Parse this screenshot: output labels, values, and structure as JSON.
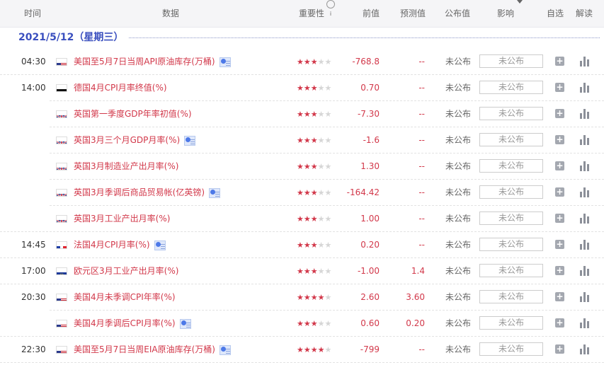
{
  "header": {
    "time": "时间",
    "data": "数据",
    "importance": "重要性",
    "previous": "前值",
    "forecast": "预测值",
    "actual": "公布值",
    "impact": "影响",
    "watchlist": "自选",
    "explain": "解读"
  },
  "date": "2021/5/12（星期三）",
  "rows": [
    {
      "time": "04:30",
      "flag": "us",
      "name": "美国至5月7日当周API原油库存(万桶)",
      "video": true,
      "stars": 3,
      "prev": "-768.8",
      "forecast": "--",
      "actual": "未公布",
      "impact": "未公布"
    },
    {
      "time": "14:00",
      "flag": "de",
      "name": "德国4月CPI月率终值(%)",
      "video": false,
      "stars": 3,
      "prev": "0.70",
      "forecast": "--",
      "actual": "未公布",
      "impact": "未公布"
    },
    {
      "time": "",
      "flag": "gb",
      "name": "英国第一季度GDP年率初值(%)",
      "video": false,
      "stars": 3,
      "prev": "-7.30",
      "forecast": "--",
      "actual": "未公布",
      "impact": "未公布"
    },
    {
      "time": "",
      "flag": "gb",
      "name": "英国3月三个月GDP月率(%)",
      "video": true,
      "stars": 3,
      "prev": "-1.6",
      "forecast": "--",
      "actual": "未公布",
      "impact": "未公布"
    },
    {
      "time": "",
      "flag": "gb",
      "name": "英国3月制造业产出月率(%)",
      "video": false,
      "stars": 3,
      "prev": "1.30",
      "forecast": "--",
      "actual": "未公布",
      "impact": "未公布"
    },
    {
      "time": "",
      "flag": "gb",
      "name": "英国3月季调后商品贸易帐(亿英镑)",
      "video": true,
      "stars": 3,
      "prev": "-164.42",
      "forecast": "--",
      "actual": "未公布",
      "impact": "未公布"
    },
    {
      "time": "",
      "flag": "gb",
      "name": "英国3月工业产出月率(%)",
      "video": false,
      "stars": 3,
      "prev": "1.00",
      "forecast": "--",
      "actual": "未公布",
      "impact": "未公布"
    },
    {
      "time": "14:45",
      "flag": "fr",
      "name": "法国4月CPI月率(%)",
      "video": true,
      "stars": 3,
      "prev": "0.20",
      "forecast": "--",
      "actual": "未公布",
      "impact": "未公布"
    },
    {
      "time": "17:00",
      "flag": "eu",
      "name": "欧元区3月工业产出月率(%)",
      "video": false,
      "stars": 3,
      "prev": "-1.00",
      "forecast": "1.4",
      "actual": "未公布",
      "impact": "未公布"
    },
    {
      "time": "20:30",
      "flag": "us",
      "name": "美国4月未季调CPI年率(%)",
      "video": false,
      "stars": 4,
      "prev": "2.60",
      "forecast": "3.60",
      "actual": "未公布",
      "impact": "未公布"
    },
    {
      "time": "",
      "flag": "us",
      "name": "美国4月季调后CPI月率(%)",
      "video": true,
      "stars": 3,
      "prev": "0.60",
      "forecast": "0.20",
      "actual": "未公布",
      "impact": "未公布"
    },
    {
      "time": "22:30",
      "flag": "us",
      "name": "美国至5月7日当周EIA原油库存(万桶)",
      "video": true,
      "stars": 4,
      "prev": "-799",
      "forecast": "--",
      "actual": "未公布",
      "impact": "未公布"
    }
  ],
  "colors": {
    "accent": "#d2384a",
    "date": "#3a4fbf"
  }
}
